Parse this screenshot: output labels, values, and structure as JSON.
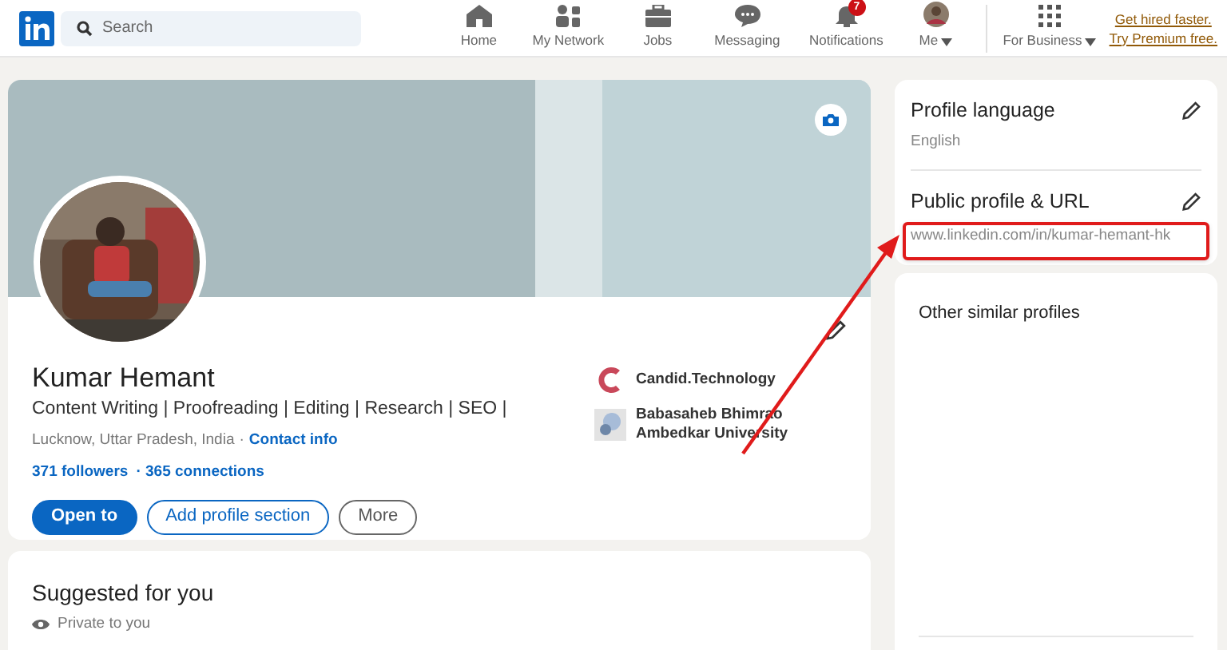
{
  "nav": {
    "search": {
      "placeholder": "Search"
    },
    "items": [
      {
        "label": "Home",
        "selected": false
      },
      {
        "label": "My Network",
        "selected": false
      },
      {
        "label": "Jobs",
        "selected": false
      },
      {
        "label": "Messaging",
        "selected": false
      },
      {
        "label": "Notifications",
        "badge": "7",
        "selected": false
      },
      {
        "label": "Me",
        "dropdown": true,
        "selected": false
      }
    ],
    "business": {
      "label": "For Business",
      "dropdown": true
    },
    "premium": [
      "Get hired faster.",
      "Try Premium free."
    ]
  },
  "profile": {
    "name": "Kumar Hemant",
    "headline": "Content Writing | Proofreading | Editing | Research | SEO |",
    "location": "Lucknow, Uttar Pradesh, India",
    "separator": "·",
    "contact": "Contact info",
    "followers": "371 followers",
    "connections": "· 365 connections",
    "affiliations": [
      {
        "kind": "company",
        "label": "Candid.Technology"
      },
      {
        "kind": "school",
        "label": "Babasaheb Bhimrao Ambedkar University"
      }
    ],
    "buttons": [
      {
        "label": "Open to",
        "kind": "primary"
      },
      {
        "label": "Add profile section",
        "kind": "outline"
      },
      {
        "label": "More",
        "kind": "secondary"
      }
    ]
  },
  "suggested": {
    "title": "Suggested for you",
    "note": "Private to you"
  },
  "settings": [
    {
      "title": "Profile language",
      "value": "English",
      "highlighted": false
    },
    {
      "title": "Public profile & URL",
      "value": "www.linkedin.com/in/kumar-hemant-hk",
      "highlighted": true
    }
  ],
  "similar": {
    "title": "Other similar profiles"
  }
}
